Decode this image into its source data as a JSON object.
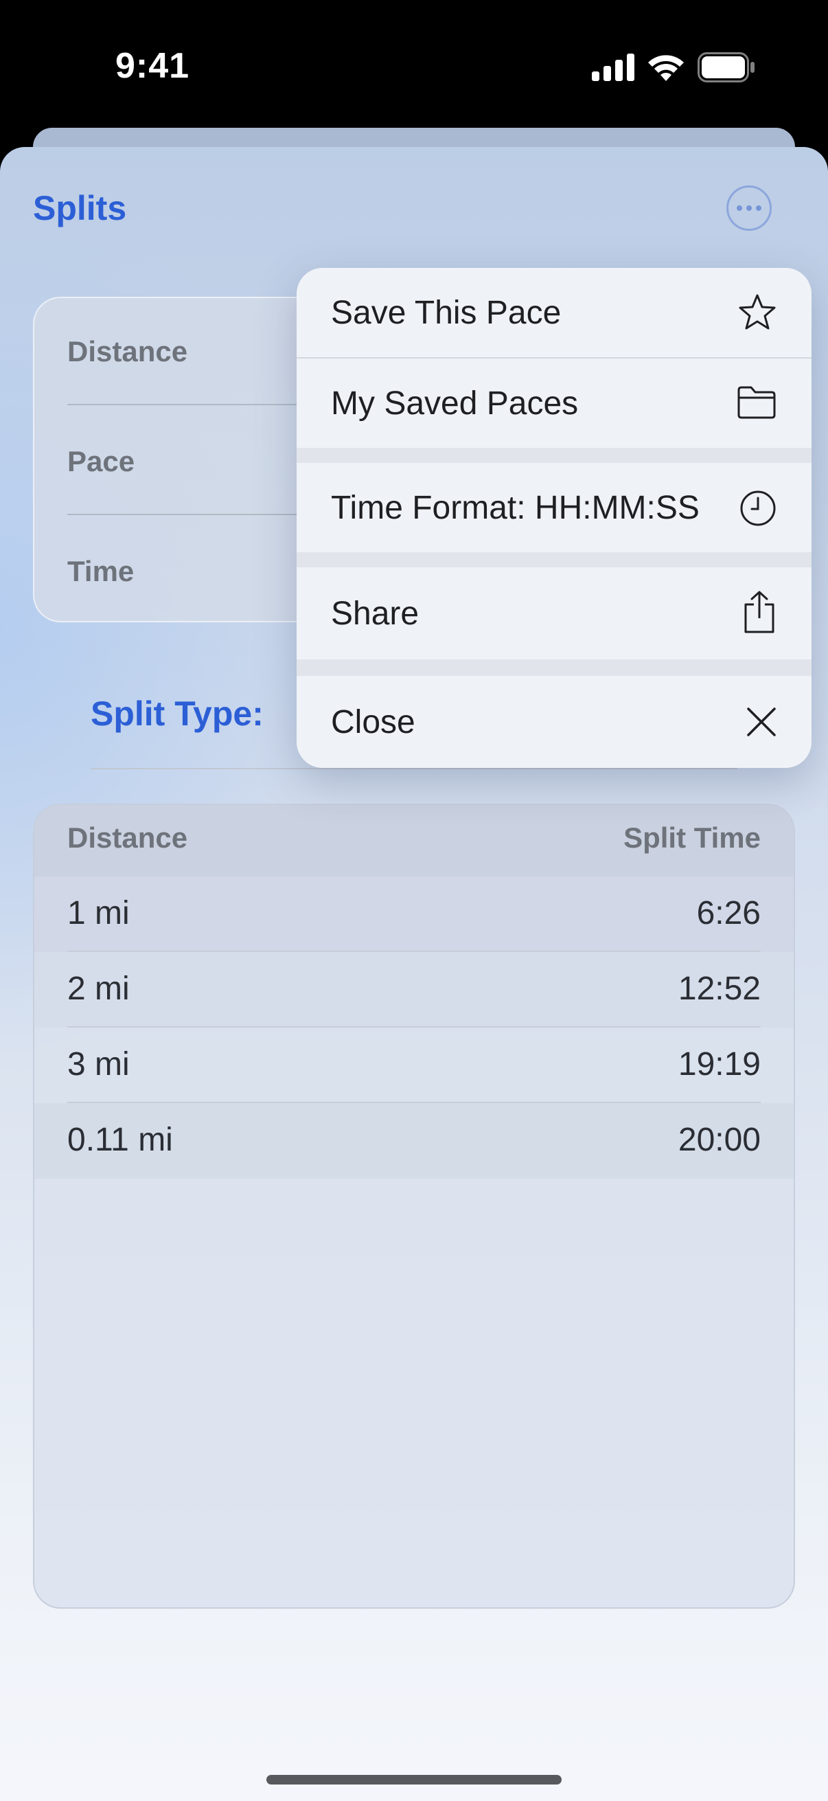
{
  "status_bar": {
    "time": "9:41"
  },
  "sheet": {
    "title": "Splits",
    "more_icon": "ellipsis-circle-icon"
  },
  "inputs": {
    "distance_label": "Distance",
    "pace_label": "Pace",
    "time_label": "Time"
  },
  "split_type_label": "Split Type:",
  "table": {
    "headers": {
      "distance": "Distance",
      "split_time": "Split Time"
    },
    "rows": [
      {
        "distance": "1 mi",
        "time": "6:26"
      },
      {
        "distance": "2 mi",
        "time": "12:52"
      },
      {
        "distance": "3 mi",
        "time": "19:19"
      },
      {
        "distance": "0.11 mi",
        "time": "20:00"
      }
    ]
  },
  "menu": {
    "items": [
      {
        "label": "Save This Pace",
        "icon": "star-icon"
      },
      {
        "label": "My Saved Paces",
        "icon": "folder-icon"
      },
      {
        "label": "Time Format: HH:MM:SS",
        "icon": "clock-icon"
      },
      {
        "label": "Share",
        "icon": "share-icon"
      },
      {
        "label": "Close",
        "icon": "close-icon"
      }
    ]
  }
}
